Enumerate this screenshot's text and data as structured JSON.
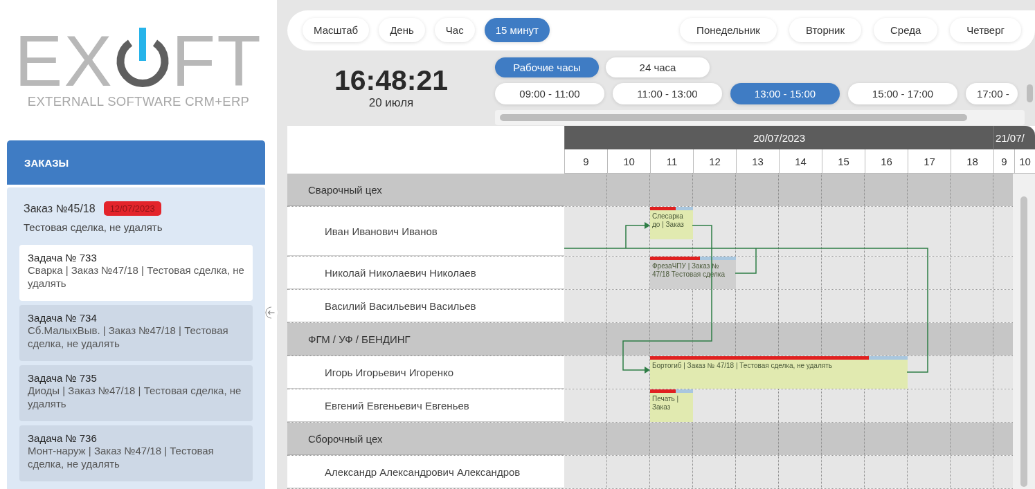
{
  "logo": {
    "left_letters": "EX",
    "right_letters": "FT",
    "tagline": "EXTERNALL SOFTWARE CRM+ERP"
  },
  "orders_panel": {
    "title": "ЗАКАЗЫ",
    "order": {
      "number": "Заказ №45/18",
      "date_badge": "12/07/2023",
      "description": "Тестовая сделка, не удалять"
    },
    "tasks": [
      {
        "title": "Задача № 733",
        "description": "Сварка | Заказ №47/18 | Тестовая сделка, не удалять",
        "selected": true
      },
      {
        "title": "Задача № 734",
        "description": "Сб.МалыхВыв. | Заказ №47/18 | Тестовая сделка, не удалять",
        "selected": false
      },
      {
        "title": "Задача № 735",
        "description": "Диоды | Заказ №47/18 | Тестовая сделка, не удалять",
        "selected": false
      },
      {
        "title": "Задача № 736",
        "description": "Монт-наруж | Заказ №47/18 | Тестовая сделка, не удалять",
        "selected": false
      }
    ]
  },
  "scale_tabs": [
    {
      "label": "Масштаб",
      "selected": false
    },
    {
      "label": "День",
      "selected": false
    },
    {
      "label": "Час",
      "selected": false
    },
    {
      "label": "15 минут",
      "selected": true
    }
  ],
  "day_tabs": [
    {
      "label": "Понедельник",
      "selected": false
    },
    {
      "label": "Вторник",
      "selected": false
    },
    {
      "label": "Среда",
      "selected": false
    },
    {
      "label": "Четверг",
      "selected": false
    }
  ],
  "clock": {
    "time": "16:48:21",
    "date": "20 июля"
  },
  "hours_mode": [
    {
      "label": "Рабочие часы",
      "selected": true
    },
    {
      "label": "24 часа",
      "selected": false
    }
  ],
  "time_slots": [
    {
      "label": "09:00 - 11:00",
      "selected": false
    },
    {
      "label": "11:00 - 13:00",
      "selected": false
    },
    {
      "label": "13:00 - 15:00",
      "selected": true
    },
    {
      "label": "15:00 - 17:00",
      "selected": false
    },
    {
      "label": "17:00 -",
      "selected": false
    }
  ],
  "gantt": {
    "dates": [
      {
        "label": "20/07/2023",
        "hours": [
          "9",
          "10",
          "11",
          "12",
          "13",
          "14",
          "15",
          "16",
          "17",
          "18"
        ]
      },
      {
        "label": "21/07/",
        "hours": [
          "9",
          "10"
        ]
      }
    ],
    "rows": [
      {
        "kind": "group",
        "name": "Сварочный цех"
      },
      {
        "kind": "person",
        "name": "Иван Иванович Иванов",
        "tasks": [
          {
            "text": "Слесарка до | Заказ",
            "level": 0.6,
            "color": "#e1eab0"
          }
        ]
      },
      {
        "kind": "person",
        "name": "Николай Николаевич Николаев",
        "tasks": [
          {
            "text": "ФрезаЧПУ | Заказ № 47/18 Тестовая сделка",
            "level": 0.58,
            "color": "#cfcfcf"
          }
        ]
      },
      {
        "kind": "person",
        "name": "Василий Васильевич Васильев",
        "tasks": []
      },
      {
        "kind": "group",
        "name": "ФГМ / УФ / БЕНДИНГ"
      },
      {
        "kind": "person",
        "name": "Игорь Игорьевич Игоренко",
        "tasks": [
          {
            "text": "Бортогиб | Заказ № 47/18 | Тестовая сделка, не удалять",
            "level": 0.85,
            "color": "#e1eab0"
          }
        ]
      },
      {
        "kind": "person",
        "name": "Евгений Евгеньевич Евгеньев",
        "tasks": [
          {
            "text": "Печать | Заказ",
            "level": 0.6,
            "color": "#e1eab0"
          }
        ]
      },
      {
        "kind": "group",
        "name": "Сборочный цех"
      },
      {
        "kind": "person",
        "name": "Александр Александрович Александров",
        "tasks": []
      }
    ]
  }
}
